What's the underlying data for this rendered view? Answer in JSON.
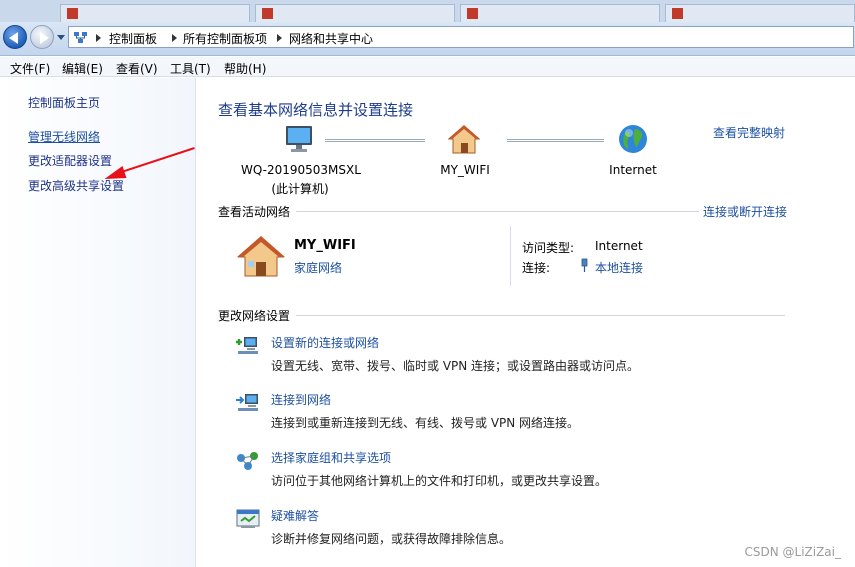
{
  "address_bar": {
    "crumbs": [
      "控制面板",
      "所有控制面板项",
      "网络和共享中心"
    ]
  },
  "menu": {
    "items": [
      "文件(F)",
      "编辑(E)",
      "查看(V)",
      "工具(T)",
      "帮助(H)"
    ]
  },
  "sidebar": {
    "home": "控制面板主页",
    "items": [
      {
        "label": "管理无线网络"
      },
      {
        "label": "更改适配器设置"
      },
      {
        "label": "更改高级共享设置"
      }
    ]
  },
  "main": {
    "title": "查看基本网络信息并设置连接",
    "full_map_link": "查看完整映射",
    "map": {
      "computer_name": "WQ-20190503MSXL",
      "computer_sub": "(此计算机)",
      "network_name": "MY_WIFI",
      "internet_label": "Internet"
    },
    "active_networks": {
      "heading": "查看活动网络",
      "connect_link": "连接或断开连接",
      "network_name": "MY_WIFI",
      "network_type": "家庭网络",
      "access_type_label": "访问类型:",
      "access_type_value": "Internet",
      "connection_label": "连接:",
      "connection_value": "本地连接"
    },
    "change_settings": {
      "heading": "更改网络设置",
      "tasks": [
        {
          "title": "设置新的连接或网络",
          "desc": "设置无线、宽带、拨号、临时或 VPN 连接；或设置路由器或访问点。",
          "icon": "new-connection-icon"
        },
        {
          "title": "连接到网络",
          "desc": "连接到或重新连接到无线、有线、拨号或 VPN 网络连接。",
          "icon": "connect-network-icon"
        },
        {
          "title": "选择家庭组和共享选项",
          "desc": "访问位于其他网络计算机上的文件和打印机，或更改共享设置。",
          "icon": "homegroup-icon"
        },
        {
          "title": "疑难解答",
          "desc": "诊断并修复网络问题，或获得故障排除信息。",
          "icon": "troubleshoot-icon"
        }
      ]
    }
  },
  "watermark": "CSDN @LiZiZai_",
  "colors": {
    "link": "#1e50a2",
    "title": "#1e3c8c",
    "annotation_arrow": "#e8101a"
  }
}
